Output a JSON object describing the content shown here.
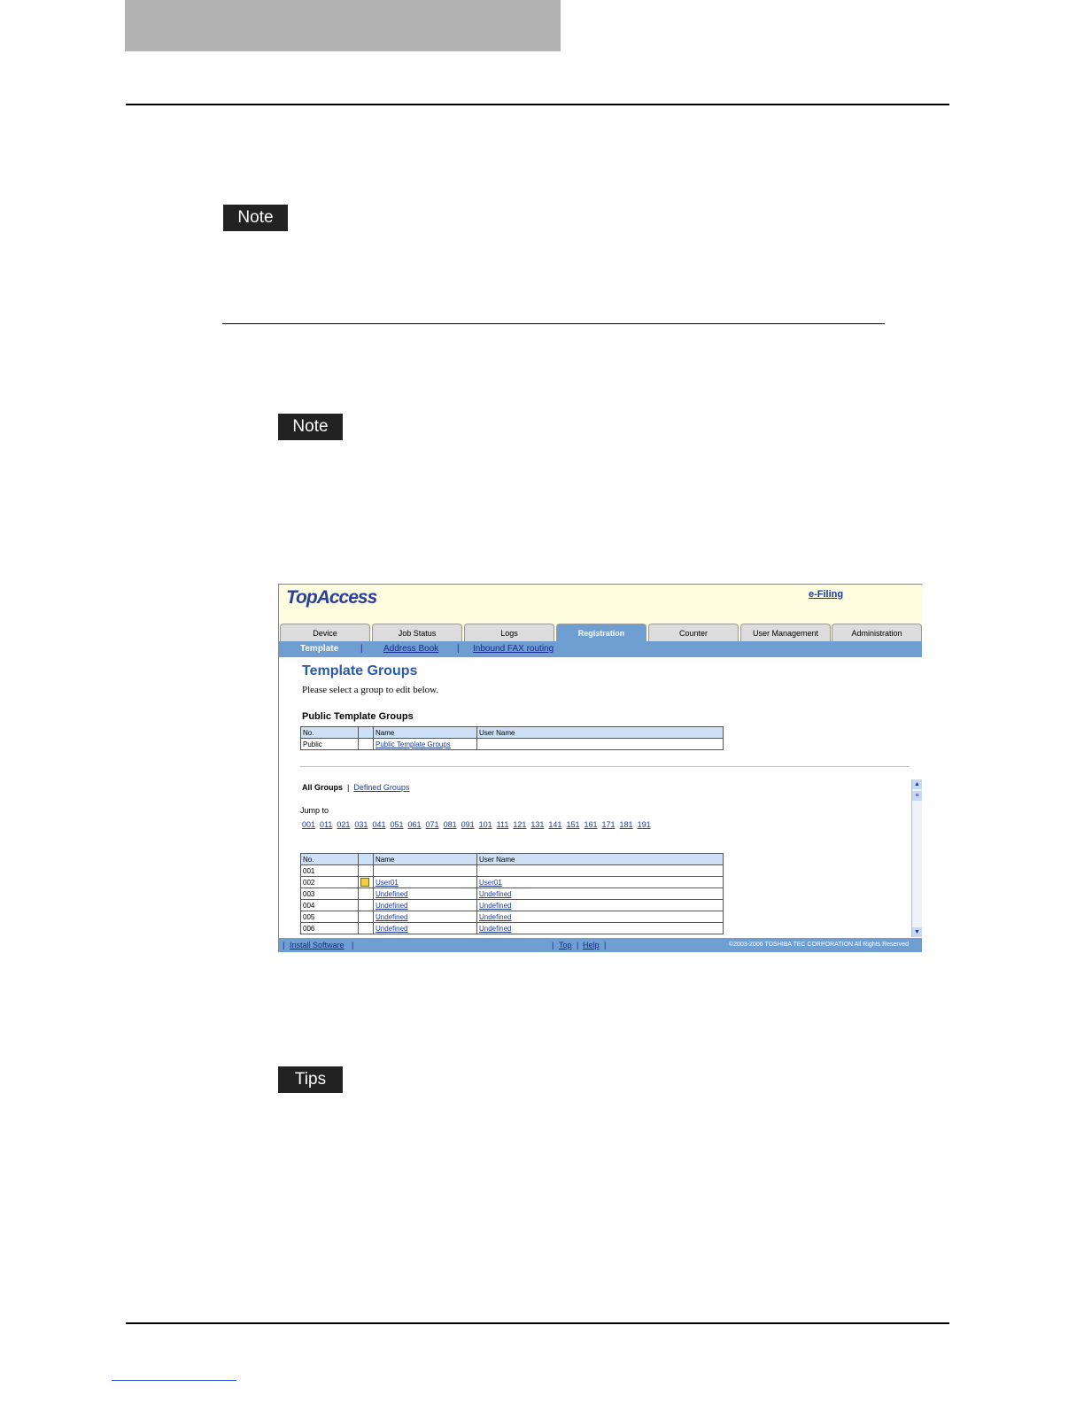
{
  "labels": {
    "note1": "Note",
    "note2": "Note",
    "tips": "Tips"
  },
  "app": {
    "logo": "TopAccess",
    "top_link": "e-Filing",
    "tabs": [
      "Device",
      "Job Status",
      "Logs",
      "Registration",
      "Counter",
      "User Management",
      "Administration"
    ],
    "active_tab": "Registration",
    "subnav": {
      "current": "Template",
      "links": [
        "Address Book",
        "Inbound FAX routing"
      ],
      "separator": "|"
    },
    "page_title": "Template Groups",
    "page_subtitle": "Please select a group to edit below.",
    "public_section_title": "Public Template Groups",
    "table_headers": [
      "No.",
      "",
      "Name",
      "User Name"
    ],
    "public_row": {
      "no": "Public",
      "name": "Public Template Groups",
      "user": ""
    },
    "group_filter": {
      "active": "All Groups",
      "separator": "|",
      "link": "Defined Groups"
    },
    "jump_to_label": "Jump to",
    "jump_links": [
      "001",
      "011",
      "021",
      "031",
      "041",
      "051",
      "061",
      "071",
      "081",
      "091",
      "101",
      "111",
      "121",
      "131",
      "141",
      "151",
      "161",
      "171",
      "181",
      "191"
    ],
    "rows": [
      {
        "no": "001",
        "name": "",
        "user": ""
      },
      {
        "no": "002",
        "name": "User01",
        "user": "User01"
      },
      {
        "no": "003",
        "name": "Undefined",
        "user": "Undefined"
      },
      {
        "no": "004",
        "name": "Undefined",
        "user": "Undefined"
      },
      {
        "no": "005",
        "name": "Undefined",
        "user": "Undefined"
      },
      {
        "no": "006",
        "name": "Undefined",
        "user": "Undefined"
      }
    ],
    "bottom": {
      "install": "Install Software",
      "top": "Top",
      "help": "Help",
      "sep": "|",
      "copyright": "©2003-2006 TOSHIBA TEC CORPORATION All Rights Reserved"
    }
  }
}
